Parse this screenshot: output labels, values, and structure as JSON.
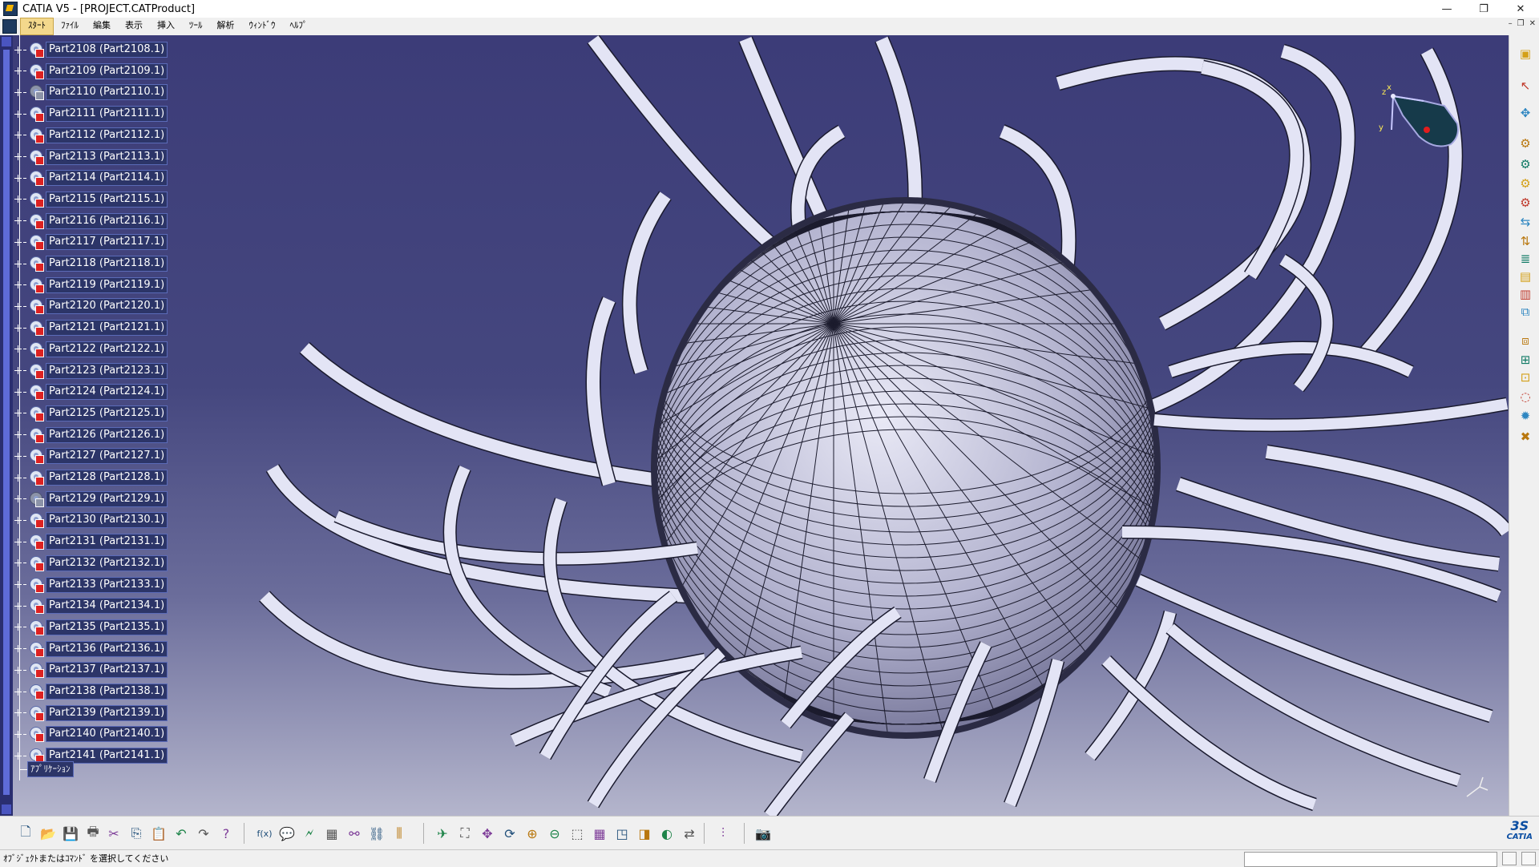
{
  "window": {
    "title": "CATIA V5 - [PROJECT.CATProduct]",
    "minimize": "—",
    "restore": "❐",
    "close": "✕"
  },
  "menu": {
    "items": [
      "ｽﾀｰﾄ",
      "ﾌｧｲﾙ",
      "編集",
      "表示",
      "挿入",
      "ﾂｰﾙ",
      "解析",
      "ｳｨﾝﾄﾞｳ",
      "ﾍﾙﾌﾟ"
    ],
    "active_index": 0,
    "mdi_controls": [
      "–",
      "❐",
      "✕"
    ]
  },
  "tree": {
    "parts": [
      {
        "label": "Part2108 (Part2108.1)",
        "hidden": false
      },
      {
        "label": "Part2109 (Part2109.1)",
        "hidden": false
      },
      {
        "label": "Part2110 (Part2110.1)",
        "hidden": true
      },
      {
        "label": "Part2111 (Part2111.1)",
        "hidden": false
      },
      {
        "label": "Part2112 (Part2112.1)",
        "hidden": false
      },
      {
        "label": "Part2113 (Part2113.1)",
        "hidden": false
      },
      {
        "label": "Part2114 (Part2114.1)",
        "hidden": false
      },
      {
        "label": "Part2115 (Part2115.1)",
        "hidden": false
      },
      {
        "label": "Part2116 (Part2116.1)",
        "hidden": false
      },
      {
        "label": "Part2117 (Part2117.1)",
        "hidden": false
      },
      {
        "label": "Part2118 (Part2118.1)",
        "hidden": false
      },
      {
        "label": "Part2119 (Part2119.1)",
        "hidden": false
      },
      {
        "label": "Part2120 (Part2120.1)",
        "hidden": false
      },
      {
        "label": "Part2121 (Part2121.1)",
        "hidden": false
      },
      {
        "label": "Part2122 (Part2122.1)",
        "hidden": false
      },
      {
        "label": "Part2123 (Part2123.1)",
        "hidden": false
      },
      {
        "label": "Part2124 (Part2124.1)",
        "hidden": false
      },
      {
        "label": "Part2125 (Part2125.1)",
        "hidden": false
      },
      {
        "label": "Part2126 (Part2126.1)",
        "hidden": false
      },
      {
        "label": "Part2127 (Part2127.1)",
        "hidden": false
      },
      {
        "label": "Part2128 (Part2128.1)",
        "hidden": false
      },
      {
        "label": "Part2129 (Part2129.1)",
        "hidden": true
      },
      {
        "label": "Part2130 (Part2130.1)",
        "hidden": false
      },
      {
        "label": "Part2131 (Part2131.1)",
        "hidden": false
      },
      {
        "label": "Part2132 (Part2132.1)",
        "hidden": false
      },
      {
        "label": "Part2133 (Part2133.1)",
        "hidden": false
      },
      {
        "label": "Part2134 (Part2134.1)",
        "hidden": false
      },
      {
        "label": "Part2135 (Part2135.1)",
        "hidden": false
      },
      {
        "label": "Part2136 (Part2136.1)",
        "hidden": false
      },
      {
        "label": "Part2137 (Part2137.1)",
        "hidden": false
      },
      {
        "label": "Part2138 (Part2138.1)",
        "hidden": false
      },
      {
        "label": "Part2139 (Part2139.1)",
        "hidden": false
      },
      {
        "label": "Part2140 (Part2140.1)",
        "hidden": false
      },
      {
        "label": "Part2141 (Part2141.1)",
        "hidden": false
      }
    ],
    "applications_label": "ｱﾌﾟﾘｹｰｼｮﾝ"
  },
  "compass": {
    "x_label": "x",
    "y_label": "y",
    "z_label": "z"
  },
  "right_toolbar": {
    "icons": [
      "catalog-icon",
      "select-arrow-icon",
      "manipulate-icon",
      "existing-component-icon",
      "new-component-icon",
      "new-product-icon",
      "new-part-icon",
      "replace-component-icon",
      "graph-tree-reorder-icon",
      "generate-numbering-icon",
      "selective-load-icon",
      "manage-representations-icon",
      "multi-instantiation-icon",
      "fast-multi-instantiation-icon",
      "reuse-pattern-icon",
      "swap-visible-space-icon",
      "hide-show-icon",
      "light-bulb-icon",
      "clash-icon"
    ]
  },
  "bottom_toolbar": {
    "icons": [
      "new-file-icon",
      "open-file-icon",
      "save-icon",
      "print-icon",
      "cut-icon",
      "copy-icon",
      "paste-icon",
      "undo-icon",
      "redo-icon",
      "whats-this-icon",
      "formula-icon",
      "comment-icon",
      "knowledge-icon",
      "table-icon",
      "hierarchy-icon",
      "constraint-icon",
      "design-table-icon",
      "fly-mode-icon",
      "fit-all-icon",
      "pan-icon",
      "rotate-icon",
      "zoom-in-icon",
      "zoom-out-icon",
      "normal-view-icon",
      "multi-view-icon",
      "iso-view-icon",
      "render-style-icon",
      "hide-show-toggle-icon",
      "swap-space-icon",
      "sectioning-icon",
      "capture-icon"
    ]
  },
  "status": {
    "message": "ｵﾌﾞｼﾞｪｸﾄまたはｺﾏﾝﾄﾞ を選択してください",
    "command_input": ""
  },
  "brand": {
    "logo_text": "CATIA",
    "ds_glyph": "3S"
  },
  "colors": {
    "viewport_top": "#3c3c78",
    "viewport_bottom": "#b4b5cc",
    "tree_label_bg": "#2c3568",
    "ribbon_fill": "#e3e4f5",
    "ribbon_edge": "#1a1a2e"
  }
}
